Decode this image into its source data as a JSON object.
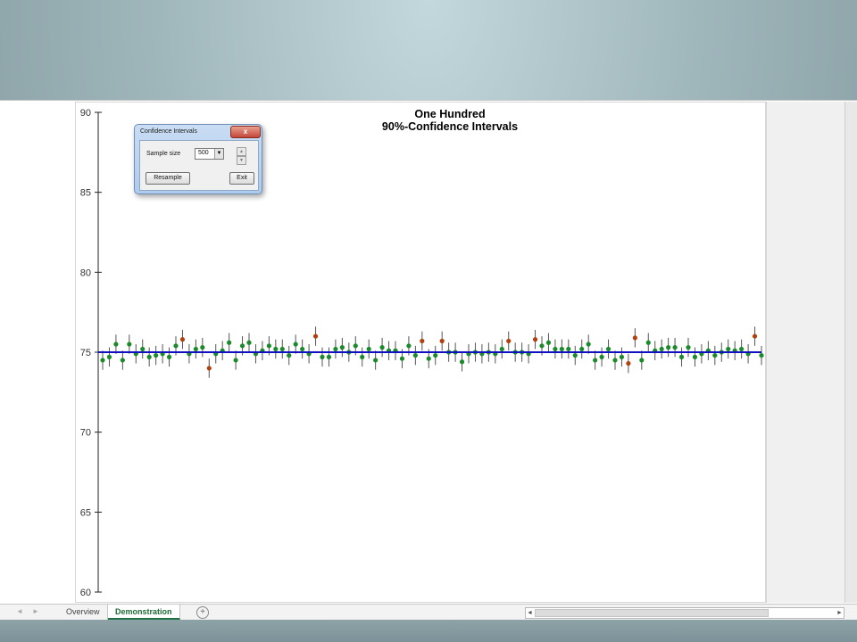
{
  "colors": {
    "mean_line": "#1010c0",
    "covers_mean": "#1a8a2a",
    "misses_mean": "#b04010",
    "whisker": "#555555",
    "sheet_tab_active": "#1e7145"
  },
  "chart_data": {
    "type": "scatter",
    "title_line1": "One Hundred",
    "title_line2": "90%-Confidence Intervals",
    "ylim": [
      60,
      90
    ],
    "yticks": [
      90,
      85,
      80,
      75,
      70,
      65,
      60
    ],
    "true_mean": 75,
    "series": [
      {
        "markers": "dot with vertical error bar",
        "intervals": [
          [
            74.5,
            73.9,
            75.1
          ],
          [
            74.7,
            74.1,
            75.3
          ],
          [
            75.5,
            74.9,
            76.1
          ],
          [
            74.5,
            73.9,
            75.1
          ],
          [
            75.5,
            74.9,
            76.1
          ],
          [
            74.9,
            74.3,
            75.5
          ],
          [
            75.2,
            74.6,
            75.8
          ],
          [
            74.7,
            74.1,
            75.3
          ],
          [
            74.8,
            74.2,
            75.4
          ],
          [
            74.9,
            74.3,
            75.5
          ],
          [
            74.7,
            74.1,
            75.3
          ],
          [
            75.4,
            74.8,
            76.0
          ],
          [
            75.8,
            75.2,
            76.4
          ],
          [
            74.9,
            74.3,
            75.5
          ],
          [
            75.2,
            74.6,
            75.8
          ],
          [
            75.3,
            74.7,
            75.9
          ],
          [
            74.0,
            73.4,
            74.6
          ],
          [
            74.9,
            74.3,
            75.5
          ],
          [
            75.1,
            74.5,
            75.7
          ],
          [
            75.6,
            75.0,
            76.2
          ],
          [
            74.5,
            73.9,
            75.1
          ],
          [
            75.4,
            74.8,
            76.0
          ],
          [
            75.6,
            75.0,
            76.2
          ],
          [
            74.9,
            74.3,
            75.5
          ],
          [
            75.1,
            74.5,
            75.7
          ],
          [
            75.4,
            74.8,
            76.0
          ],
          [
            75.2,
            74.6,
            75.8
          ],
          [
            75.2,
            74.6,
            75.8
          ],
          [
            74.8,
            74.2,
            75.4
          ],
          [
            75.5,
            74.9,
            76.1
          ],
          [
            75.2,
            74.6,
            75.8
          ],
          [
            74.9,
            74.3,
            75.5
          ],
          [
            76.0,
            75.4,
            76.6
          ],
          [
            74.7,
            74.1,
            75.3
          ],
          [
            74.7,
            74.1,
            75.3
          ],
          [
            75.2,
            74.6,
            75.8
          ],
          [
            75.3,
            74.7,
            75.9
          ],
          [
            75.0,
            74.4,
            75.6
          ],
          [
            75.4,
            74.8,
            76.0
          ],
          [
            74.7,
            74.1,
            75.3
          ],
          [
            75.2,
            74.6,
            75.8
          ],
          [
            74.5,
            73.9,
            75.1
          ],
          [
            75.3,
            74.7,
            75.9
          ],
          [
            75.1,
            74.5,
            75.7
          ],
          [
            75.1,
            74.5,
            75.7
          ],
          [
            74.6,
            74.0,
            75.2
          ],
          [
            75.4,
            74.8,
            76.0
          ],
          [
            74.8,
            74.2,
            75.4
          ],
          [
            75.7,
            75.1,
            76.3
          ],
          [
            74.6,
            74.0,
            75.2
          ],
          [
            74.8,
            74.2,
            75.4
          ],
          [
            75.7,
            75.1,
            76.3
          ],
          [
            75.0,
            74.4,
            75.6
          ],
          [
            75.0,
            74.4,
            75.6
          ],
          [
            74.4,
            73.8,
            75.0
          ],
          [
            74.9,
            74.3,
            75.5
          ],
          [
            75.0,
            74.4,
            75.6
          ],
          [
            74.9,
            74.3,
            75.5
          ],
          [
            75.0,
            74.4,
            75.6
          ],
          [
            74.9,
            74.3,
            75.5
          ],
          [
            75.2,
            74.6,
            75.8
          ],
          [
            75.7,
            75.1,
            76.3
          ],
          [
            75.0,
            74.4,
            75.6
          ],
          [
            75.0,
            74.4,
            75.6
          ],
          [
            74.9,
            74.3,
            75.5
          ],
          [
            75.8,
            75.2,
            76.4
          ],
          [
            75.4,
            74.8,
            76.0
          ],
          [
            75.6,
            75.0,
            76.2
          ],
          [
            75.2,
            74.6,
            75.8
          ],
          [
            75.2,
            74.6,
            75.8
          ],
          [
            75.2,
            74.6,
            75.8
          ],
          [
            74.8,
            74.2,
            75.4
          ],
          [
            75.2,
            74.6,
            75.8
          ],
          [
            75.5,
            74.9,
            76.1
          ],
          [
            74.5,
            73.9,
            75.1
          ],
          [
            74.7,
            74.1,
            75.3
          ],
          [
            75.2,
            74.6,
            75.8
          ],
          [
            74.5,
            73.9,
            75.1
          ],
          [
            74.7,
            74.1,
            75.3
          ],
          [
            74.3,
            73.7,
            74.9
          ],
          [
            75.9,
            75.3,
            76.5
          ],
          [
            74.5,
            73.9,
            75.1
          ],
          [
            75.6,
            75.0,
            76.2
          ],
          [
            75.1,
            74.5,
            75.7
          ],
          [
            75.2,
            74.6,
            75.8
          ],
          [
            75.3,
            74.7,
            75.9
          ],
          [
            75.3,
            74.7,
            75.9
          ],
          [
            74.7,
            74.1,
            75.3
          ],
          [
            75.3,
            74.7,
            75.9
          ],
          [
            74.7,
            74.1,
            75.3
          ],
          [
            74.9,
            74.3,
            75.5
          ],
          [
            75.1,
            74.5,
            75.7
          ],
          [
            74.8,
            74.2,
            75.4
          ],
          [
            75.0,
            74.4,
            75.6
          ],
          [
            75.2,
            74.6,
            75.8
          ],
          [
            75.1,
            74.5,
            75.7
          ],
          [
            75.2,
            74.6,
            75.8
          ],
          [
            74.9,
            74.3,
            75.5
          ],
          [
            76.0,
            75.4,
            76.6
          ],
          [
            74.8,
            74.2,
            75.4
          ]
        ]
      }
    ],
    "grid": false
  },
  "dialog": {
    "title": "Confidence Intervals",
    "close_glyph": "x",
    "sample_label": "Sample size",
    "sample_value": "500",
    "combo_arrow": "▼",
    "spin_up": "▲",
    "spin_down": "▼",
    "resample_label": "Resample",
    "exit_label": "Exit"
  },
  "tabbar": {
    "prev_arrow": "◄",
    "next_arrow": "►",
    "tabs": [
      "Overview",
      "Demonstration"
    ],
    "active_tab": "Demonstration",
    "add_glyph": "+",
    "hscroll_left": "◄",
    "hscroll_right": "►"
  }
}
